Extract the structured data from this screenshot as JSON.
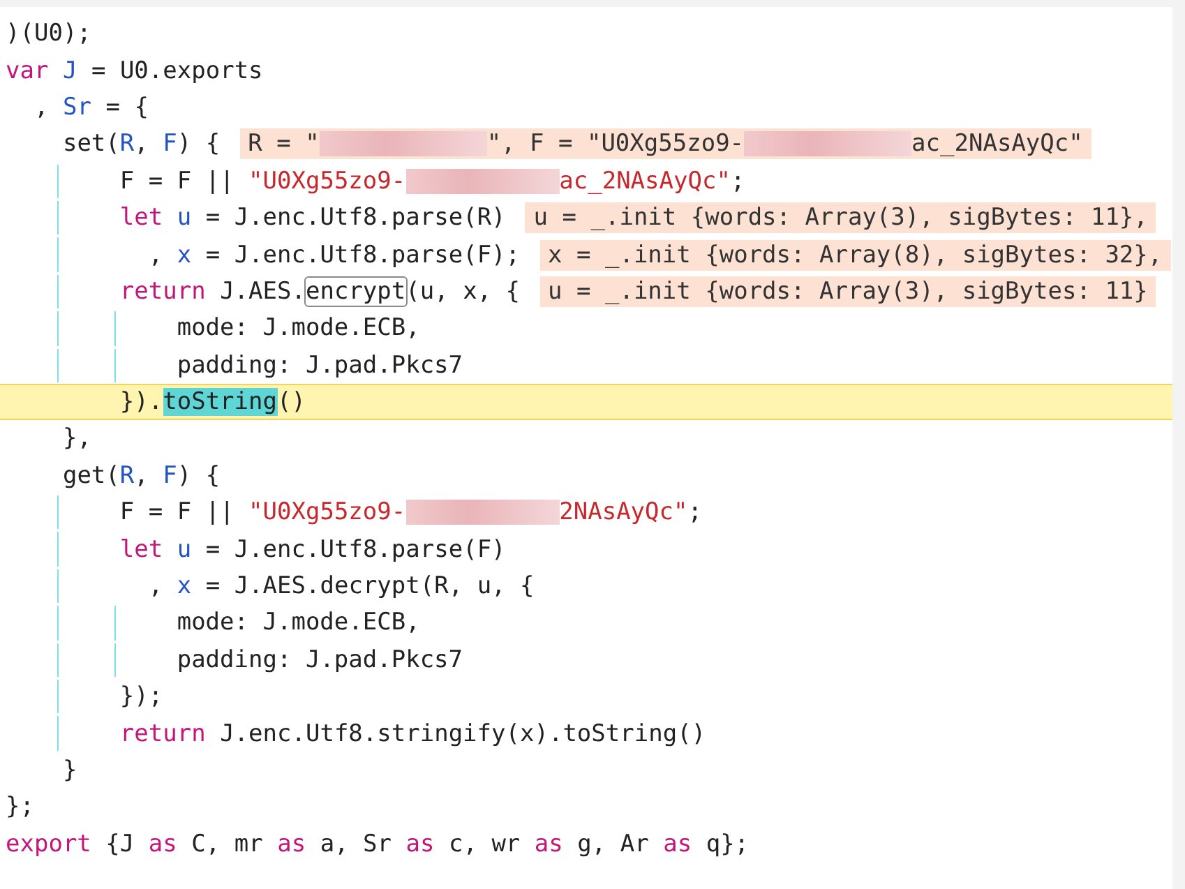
{
  "editor": {
    "lines": [
      {
        "highlighted": false,
        "tokens": [
          {
            "kind": "plain",
            "text": ")(U0);"
          }
        ]
      },
      {
        "highlighted": false,
        "tokens": [
          {
            "kind": "keyword",
            "text": "var"
          },
          {
            "kind": "def",
            "text": " J"
          },
          {
            "kind": "plain",
            "text": " = U0.exports"
          }
        ]
      },
      {
        "highlighted": false,
        "tokens": [
          {
            "kind": "plain",
            "text": "  , "
          },
          {
            "kind": "def",
            "text": "Sr"
          },
          {
            "kind": "plain",
            "text": " = {"
          }
        ]
      },
      {
        "highlighted": false,
        "tokens": [
          {
            "kind": "plain",
            "text": "    set("
          },
          {
            "kind": "def",
            "text": "R"
          },
          {
            "kind": "plain",
            "text": ", "
          },
          {
            "kind": "def",
            "text": "F"
          },
          {
            "kind": "plain",
            "text": ") {"
          }
        ],
        "annotation": [
          {
            "kind": "text",
            "text": "R = \""
          },
          {
            "kind": "redacted"
          },
          {
            "kind": "text",
            "text": "\", F = \"U0Xg55zo9-"
          },
          {
            "kind": "redacted"
          },
          {
            "kind": "text",
            "text": "ac_2NAsAyQc\""
          }
        ]
      },
      {
        "highlighted": false,
        "guides": [
          true
        ],
        "tokens": [
          {
            "kind": "plain",
            "text": "        F = F || "
          },
          {
            "kind": "string",
            "text": "\"U0Xg55zo9-"
          },
          {
            "kind": "redacted"
          },
          {
            "kind": "string",
            "text": "ac_2NAsAyQc\""
          },
          {
            "kind": "plain",
            "text": ";"
          }
        ]
      },
      {
        "highlighted": false,
        "guides": [
          true
        ],
        "tokens": [
          {
            "kind": "keyword",
            "text": "        let"
          },
          {
            "kind": "def",
            "text": " u"
          },
          {
            "kind": "plain",
            "text": " = J.enc.Utf8.parse(R)"
          }
        ],
        "annotation": [
          {
            "kind": "text",
            "text": "u = _.init {words: Array(3), sigBytes: 11},"
          }
        ]
      },
      {
        "highlighted": false,
        "guides": [
          true
        ],
        "tokens": [
          {
            "kind": "plain",
            "text": "          , "
          },
          {
            "kind": "def",
            "text": "x"
          },
          {
            "kind": "plain",
            "text": " = J.enc.Utf8.parse(F);"
          }
        ],
        "annotation": [
          {
            "kind": "text",
            "text": "x = _.init {words: Array(8), sigBytes: 32},"
          }
        ]
      },
      {
        "highlighted": false,
        "guides": [
          true
        ],
        "tokens": [
          {
            "kind": "keyword",
            "text": "        return"
          },
          {
            "kind": "plain",
            "text": " J.AES."
          },
          {
            "kind": "outlined",
            "text": "encrypt"
          },
          {
            "kind": "plain",
            "text": "(u, x, {"
          }
        ],
        "annotation": [
          {
            "kind": "text",
            "text": "u = _.init {words: Array(3), sigBytes: 11}"
          }
        ]
      },
      {
        "highlighted": false,
        "guides": [
          true,
          true
        ],
        "tokens": [
          {
            "kind": "plain",
            "text": "            mode: J.mode.ECB,"
          }
        ]
      },
      {
        "highlighted": false,
        "guides": [
          true,
          true
        ],
        "tokens": [
          {
            "kind": "plain",
            "text": "            padding: J.pad.Pkcs7"
          }
        ]
      },
      {
        "highlighted": true,
        "tokens": [
          {
            "kind": "plain",
            "text": "        })."
          },
          {
            "kind": "match",
            "text": "toString"
          },
          {
            "kind": "plain",
            "text": "()"
          }
        ]
      },
      {
        "highlighted": false,
        "tokens": [
          {
            "kind": "plain",
            "text": "    },"
          }
        ]
      },
      {
        "highlighted": false,
        "tokens": [
          {
            "kind": "plain",
            "text": "    get("
          },
          {
            "kind": "def",
            "text": "R"
          },
          {
            "kind": "plain",
            "text": ", "
          },
          {
            "kind": "def",
            "text": "F"
          },
          {
            "kind": "plain",
            "text": ") {"
          }
        ]
      },
      {
        "highlighted": false,
        "guides": [
          true
        ],
        "tokens": [
          {
            "kind": "plain",
            "text": "        F = F || "
          },
          {
            "kind": "string",
            "text": "\"U0Xg55zo9-"
          },
          {
            "kind": "redacted"
          },
          {
            "kind": "string",
            "text": "2NAsAyQc\""
          },
          {
            "kind": "plain",
            "text": ";"
          }
        ]
      },
      {
        "highlighted": false,
        "guides": [
          true
        ],
        "tokens": [
          {
            "kind": "keyword",
            "text": "        let"
          },
          {
            "kind": "def",
            "text": " u"
          },
          {
            "kind": "plain",
            "text": " = J.enc.Utf8.parse(F)"
          }
        ]
      },
      {
        "highlighted": false,
        "guides": [
          true
        ],
        "tokens": [
          {
            "kind": "plain",
            "text": "          , "
          },
          {
            "kind": "def",
            "text": "x"
          },
          {
            "kind": "plain",
            "text": " = J.AES.decrypt(R, u, {"
          }
        ]
      },
      {
        "highlighted": false,
        "guides": [
          true,
          true
        ],
        "tokens": [
          {
            "kind": "plain",
            "text": "            mode: J.mode.ECB,"
          }
        ]
      },
      {
        "highlighted": false,
        "guides": [
          true,
          true
        ],
        "tokens": [
          {
            "kind": "plain",
            "text": "            padding: J.pad.Pkcs7"
          }
        ]
      },
      {
        "highlighted": false,
        "guides": [
          true
        ],
        "tokens": [
          {
            "kind": "plain",
            "text": "        });"
          }
        ]
      },
      {
        "highlighted": false,
        "guides": [
          true
        ],
        "tokens": [
          {
            "kind": "keyword",
            "text": "        return"
          },
          {
            "kind": "plain",
            "text": " J.enc.Utf8.stringify(x).toString()"
          }
        ]
      },
      {
        "highlighted": false,
        "tokens": [
          {
            "kind": "plain",
            "text": "    }"
          }
        ]
      },
      {
        "highlighted": false,
        "tokens": [
          {
            "kind": "plain",
            "text": "};"
          }
        ]
      },
      {
        "highlighted": false,
        "tokens": [
          {
            "kind": "keyword",
            "text": "export"
          },
          {
            "kind": "plain",
            "text": " {J "
          },
          {
            "kind": "keyword",
            "text": "as"
          },
          {
            "kind": "plain",
            "text": " C, mr "
          },
          {
            "kind": "keyword",
            "text": "as"
          },
          {
            "kind": "plain",
            "text": " a, Sr "
          },
          {
            "kind": "keyword",
            "text": "as"
          },
          {
            "kind": "plain",
            "text": " c, wr "
          },
          {
            "kind": "keyword",
            "text": "as"
          },
          {
            "kind": "plain",
            "text": " g, Ar "
          },
          {
            "kind": "keyword",
            "text": "as"
          },
          {
            "kind": "plain",
            "text": " q};"
          }
        ]
      }
    ]
  }
}
